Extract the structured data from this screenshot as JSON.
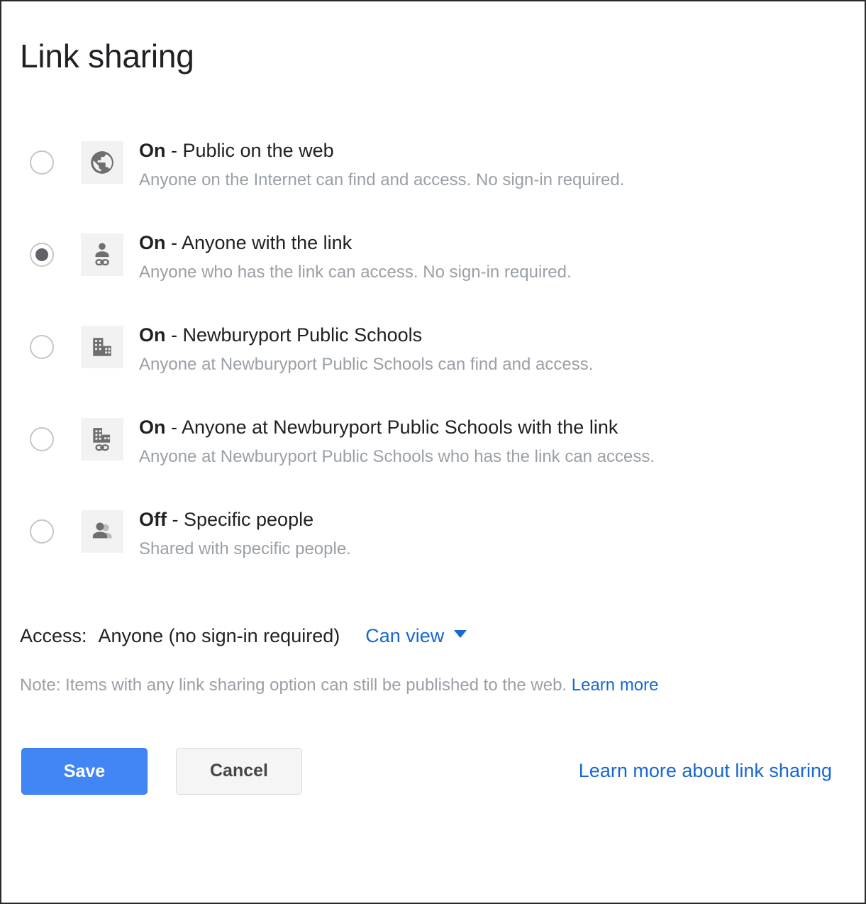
{
  "dialog": {
    "title": "Link sharing"
  },
  "options": [
    {
      "icon": "globe-icon",
      "state": "On",
      "separator": " - ",
      "label": "Public on the web",
      "description": "Anyone on the Internet can find and access. No sign-in required.",
      "selected": false
    },
    {
      "icon": "person-link-icon",
      "state": "On",
      "separator": " - ",
      "label": "Anyone with the link",
      "description": "Anyone who has the link can access. No sign-in required.",
      "selected": true
    },
    {
      "icon": "building-icon",
      "state": "On",
      "separator": " - ",
      "label": "Newburyport Public Schools",
      "description": "Anyone at Newburyport Public Schools can find and access.",
      "selected": false
    },
    {
      "icon": "building-link-icon",
      "state": "On",
      "separator": " - ",
      "label": "Anyone at Newburyport Public Schools with the link",
      "description": "Anyone at Newburyport Public Schools who has the link can access.",
      "selected": false
    },
    {
      "icon": "people-icon",
      "state": "Off",
      "separator": " - ",
      "label": "Specific people",
      "description": "Shared with specific people.",
      "selected": false
    }
  ],
  "access": {
    "label": "Access:",
    "value": "Anyone (no sign-in required)",
    "permission": "Can view",
    "caret_icon": "chevron-down-icon"
  },
  "note": {
    "text": "Note: Items with any link sharing option can still be published to the web.",
    "link_label": "Learn more"
  },
  "footer": {
    "save_label": "Save",
    "cancel_label": "Cancel",
    "help_link_label": "Learn more about link sharing"
  },
  "colors": {
    "accent_blue": "#4285f4",
    "link_blue": "#1967d2",
    "icon_gray": "#6e6e6e",
    "tile_bg": "#f2f2f2",
    "text_primary": "#202124",
    "text_secondary": "#9aa0a6",
    "radio_ring": "#c6c6c6",
    "radio_dot": "#5f6368"
  }
}
